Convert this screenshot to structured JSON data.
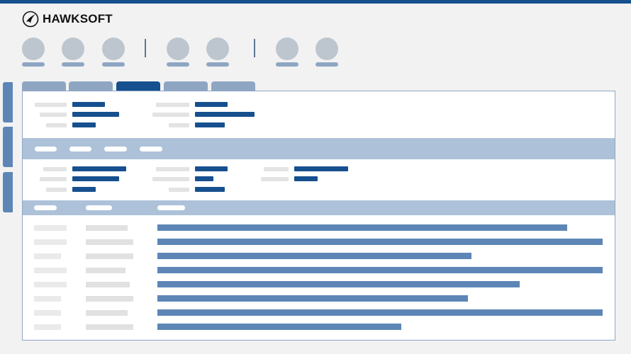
{
  "app": {
    "brand_name": "HAWKSOFT",
    "accent_color": "#16508e",
    "bar_color": "#5d86b6",
    "header_color": "#adc2d9"
  },
  "toolbar": {
    "buttons": [
      {
        "icon": "toolbar-button-1-icon"
      },
      {
        "icon": "toolbar-button-2-icon"
      },
      {
        "icon": "toolbar-button-3-icon"
      },
      {
        "icon": "toolbar-button-4-icon"
      },
      {
        "icon": "toolbar-button-5-icon"
      },
      {
        "icon": "toolbar-button-6-icon"
      },
      {
        "icon": "toolbar-button-7-icon"
      }
    ]
  },
  "tabs": {
    "count": 5,
    "active_index": 2
  },
  "rows": [
    {
      "bar_fraction": 0.92
    },
    {
      "bar_fraction": 1.0
    },
    {
      "bar_fraction": 0.705
    },
    {
      "bar_fraction": 1.0
    },
    {
      "bar_fraction": 0.813
    },
    {
      "bar_fraction": 0.697
    },
    {
      "bar_fraction": 1.0
    },
    {
      "bar_fraction": 0.548
    }
  ]
}
